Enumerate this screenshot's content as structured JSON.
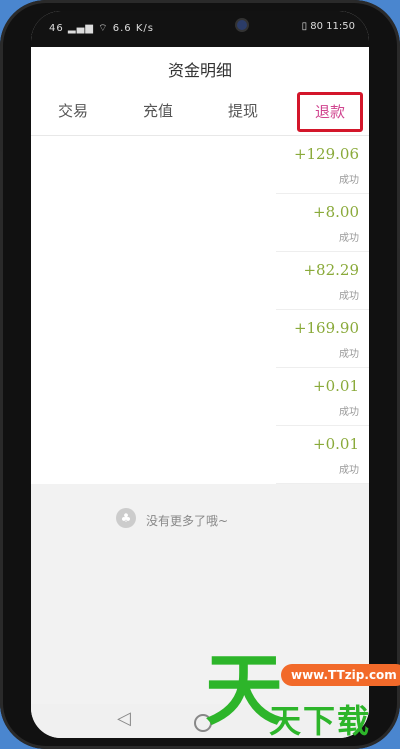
{
  "status_bar": {
    "left": "46 ▂▄▆ ⌔ 6.6 K/s",
    "right": "▯ 80 11:50"
  },
  "header": {
    "title": "资金明细"
  },
  "tabs": [
    {
      "label": "交易"
    },
    {
      "label": "充值"
    },
    {
      "label": "提现"
    },
    {
      "label": "退款",
      "active": true
    }
  ],
  "records": [
    {
      "amount": "+129.06",
      "status": "成功"
    },
    {
      "amount": "+8.00",
      "status": "成功"
    },
    {
      "amount": "+82.29",
      "status": "成功"
    },
    {
      "amount": "+169.90",
      "status": "成功"
    },
    {
      "amount": "+0.01",
      "status": "成功"
    },
    {
      "amount": "+0.01",
      "status": "成功"
    }
  ],
  "footer": {
    "no_more_text": "没有更多了哦~"
  },
  "watermark": {
    "big": "天",
    "url": "www.TTzip.com",
    "small": "天下载"
  },
  "colors": {
    "amount": "#8aaa3a",
    "active_tab": "#d0448f",
    "highlight_border": "#d3162a",
    "watermark_green": "#2db52a",
    "watermark_orange": "#f26a2a"
  }
}
